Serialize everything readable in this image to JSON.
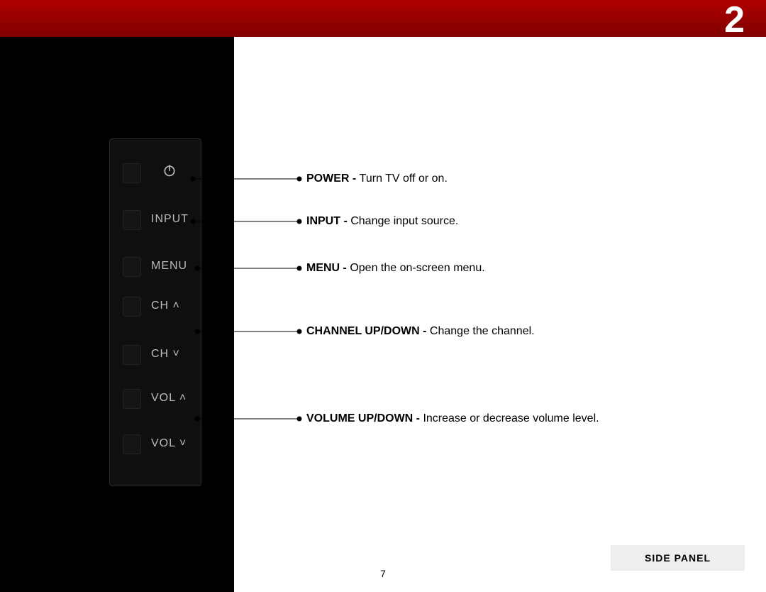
{
  "chapter": "2",
  "buttons": {
    "power_label": "",
    "input": "INPUT",
    "menu": "MENU",
    "ch_up": "CH   ˄",
    "ch_dn": "CH   ˅",
    "vol_up": "VOL ˄",
    "vol_dn": "VOL ˅"
  },
  "callouts": {
    "power_bold": "POWER - ",
    "power_desc": "Turn TV off or on.",
    "input_bold": "INPUT - ",
    "input_desc": "Change input source.",
    "menu_bold": "MENU - ",
    "menu_desc": "Open the on-screen menu.",
    "channel_bold": "CHANNEL UP/DOWN - ",
    "channel_desc": "Change the channel.",
    "volume_bold": "VOLUME UP/DOWN - ",
    "volume_desc": "Increase or decrease volume level."
  },
  "footer": "SIDE PANEL",
  "page_number": "7"
}
